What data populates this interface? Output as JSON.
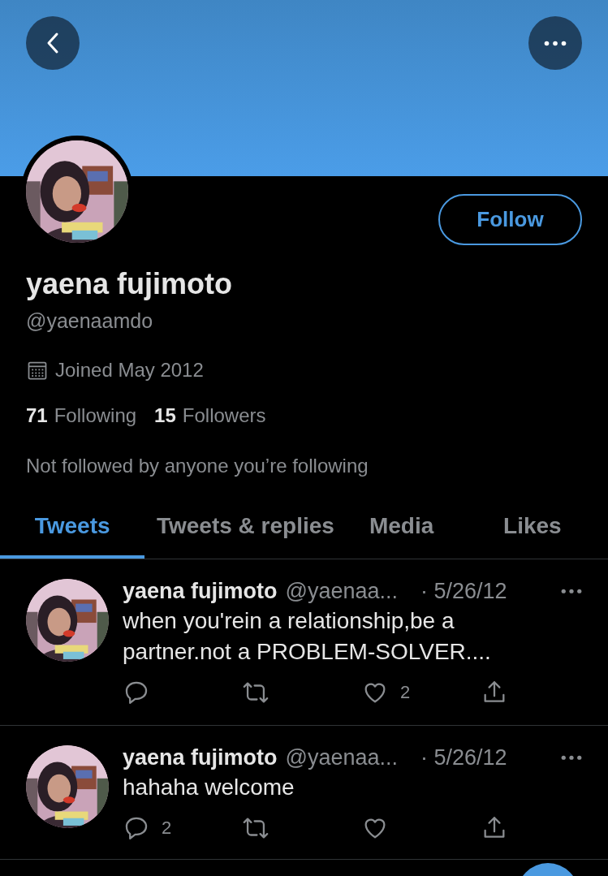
{
  "profile": {
    "name": "yaena fujimoto",
    "handle": "@yaenaamdo",
    "joined": "Joined May 2012",
    "following_count": "71",
    "following_label": "Following",
    "followers_count": "15",
    "followers_label": "Followers",
    "mutuals": "Not followed by anyone you’re following",
    "follow_button": "Follow"
  },
  "tabs": [
    {
      "label": "Tweets",
      "selected": true
    },
    {
      "label": "Tweets & replies",
      "selected": false
    },
    {
      "label": "Media",
      "selected": false
    },
    {
      "label": "Likes",
      "selected": false
    }
  ],
  "tweets": [
    {
      "name": "yaena fujimoto",
      "handle": "@yaenaa...",
      "date": "· 5/26/12",
      "text": "when you'rein a relationship,be a partner.not a PROBLEM-SOLVER....",
      "actions": [
        {
          "kind": "reply"
        },
        {
          "kind": "retweet"
        },
        {
          "kind": "like",
          "count": "2"
        },
        {
          "kind": "share"
        }
      ]
    },
    {
      "name": "yaena fujimoto",
      "handle": "@yaenaa...",
      "date": "· 5/26/12",
      "text": "hahaha welcome",
      "actions": [
        {
          "kind": "reply",
          "count": "2"
        },
        {
          "kind": "retweet"
        },
        {
          "kind": "like"
        },
        {
          "kind": "share"
        }
      ]
    }
  ]
}
